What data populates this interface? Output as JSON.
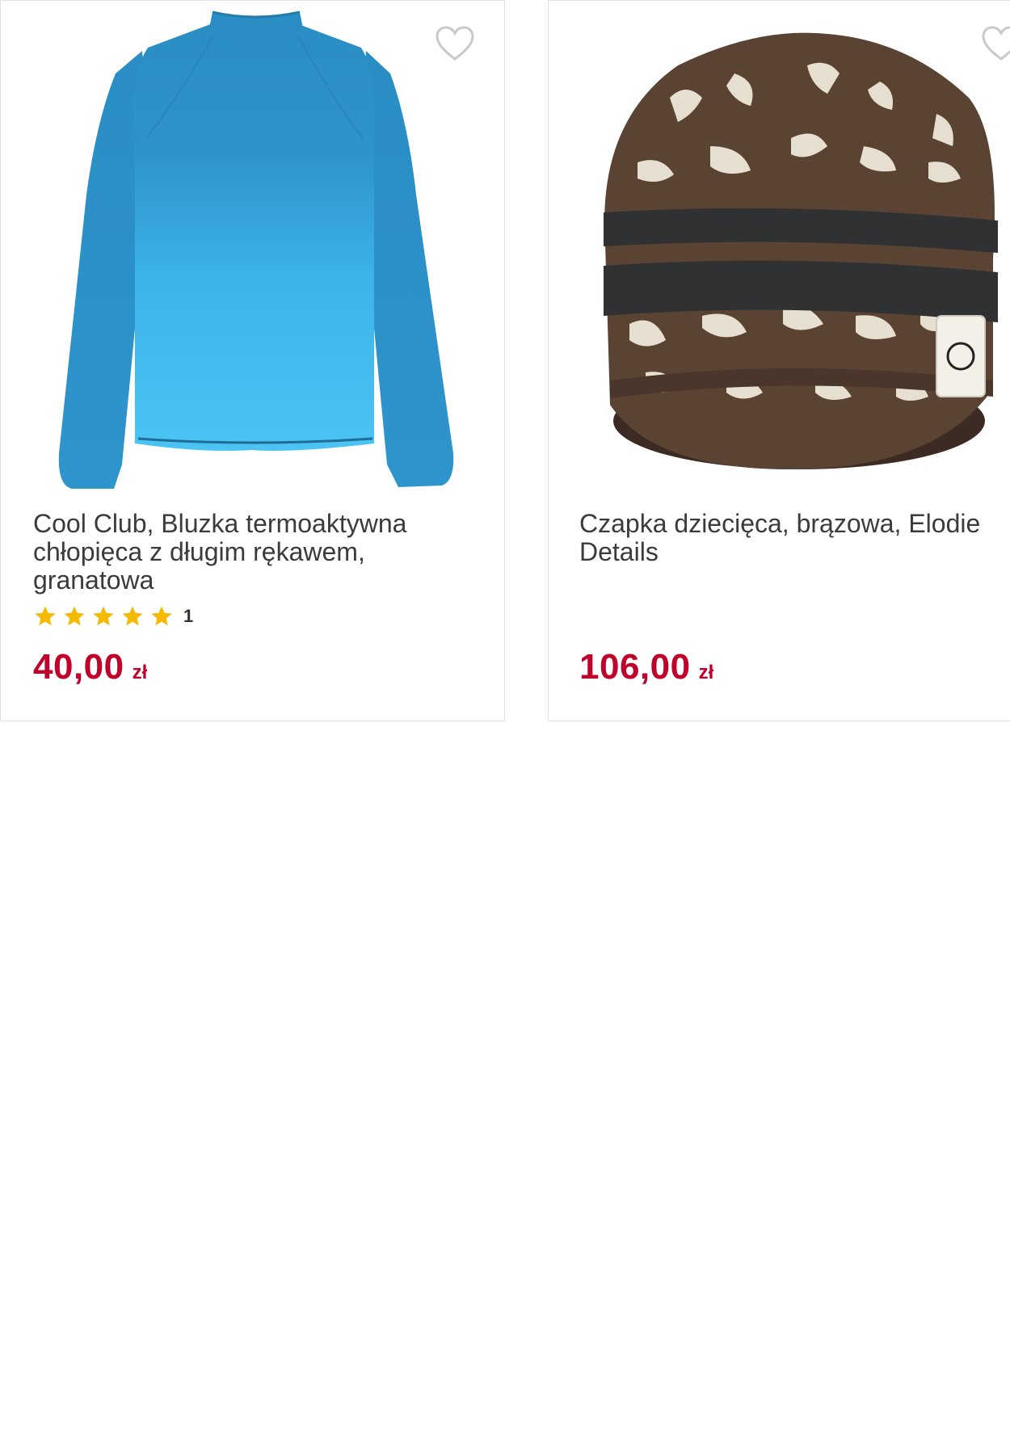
{
  "products": [
    {
      "title": "Cool Club, Bluzka termoaktywna chłopięca z długim rękawem, granatowa",
      "rating_stars": 5,
      "rating_count": "1",
      "price_amount": "40,00",
      "price_currency": "zł",
      "image": "blue-long-sleeve-shirt"
    },
    {
      "title": "Czapka dziecięca, brązowa, Elodie Details",
      "price_amount": "106,00",
      "price_currency": "zł",
      "image": "brown-patterned-beanie"
    }
  ],
  "icons": {
    "wishlist": "heart-outline-icon",
    "rating": "star-icon"
  },
  "colors": {
    "price": "#c0002a",
    "star": "#f5b900",
    "title": "#3b3b3b",
    "border": "#e2e2e2"
  }
}
